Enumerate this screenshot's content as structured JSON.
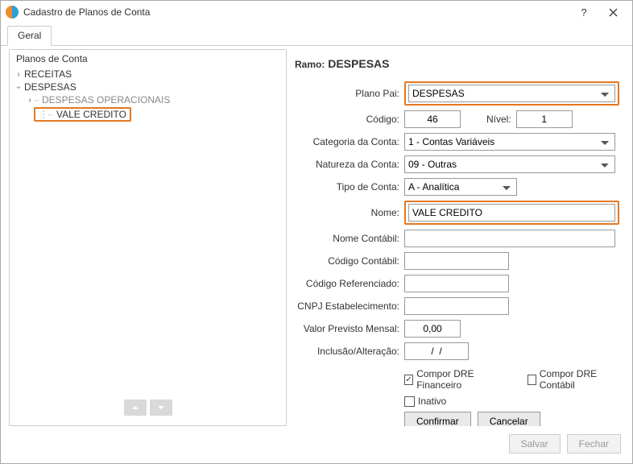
{
  "window": {
    "title": "Cadastro de Planos de Conta"
  },
  "tabs": {
    "geral": "Geral"
  },
  "tree": {
    "title": "Planos de Conta",
    "receitas": "RECEITAS",
    "despesas": "DESPESAS",
    "despesas_oper": "DESPESAS OPERACIONAIS",
    "vale_credito": "VALE CREDITO"
  },
  "form": {
    "ramo_label": "Ramo:",
    "ramo_value": "DESPESAS",
    "labels": {
      "plano_pai": "Plano Pai:",
      "codigo": "Código:",
      "nivel": "Nível:",
      "categoria": "Categoria da Conta:",
      "natureza": "Natureza da Conta:",
      "tipo": "Tipo de Conta:",
      "nome": "Nome:",
      "nome_contabil": "Nome Contábil:",
      "codigo_contabil": "Código Contábil:",
      "codigo_ref": "Código Referenciado:",
      "cnpj": "CNPJ Estabelecimento:",
      "valor_prev": "Valor Previsto Mensal:",
      "inclusao": "Inclusão/Alteração:"
    },
    "values": {
      "plano_pai": "DESPESAS",
      "codigo": "46",
      "nivel": "1",
      "categoria": "1 - Contas Variáveis",
      "natureza": "09 - Outras",
      "tipo": "A - Analítica",
      "nome": "VALE CREDITO",
      "nome_contabil": "",
      "codigo_contabil": "",
      "codigo_ref": "",
      "cnpj": "",
      "valor_prev": "0,00",
      "inclusao": "/  /"
    },
    "checks": {
      "dre_fin": "Compor DRE Financeiro",
      "dre_cont": "Compor DRE Contábil",
      "inativo": "Inativo"
    },
    "buttons": {
      "confirmar": "Confirmar",
      "cancelar": "Cancelar",
      "salvar": "Salvar",
      "fechar": "Fechar"
    }
  }
}
